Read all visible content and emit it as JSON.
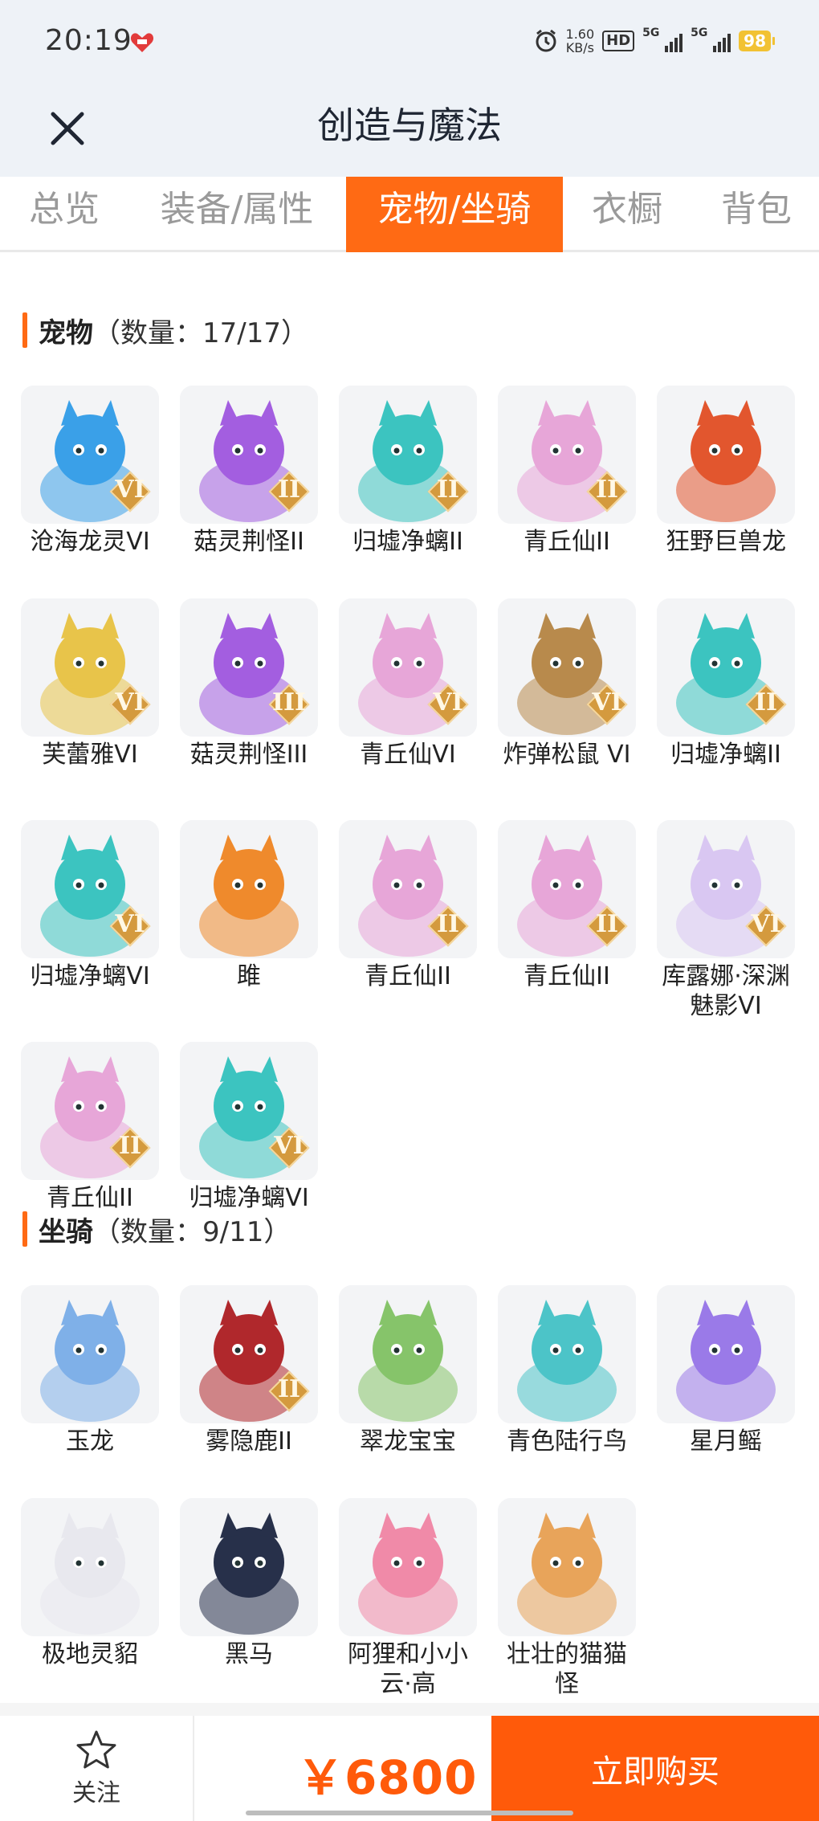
{
  "status_bar": {
    "time": "20:19",
    "speed_value": "1.60",
    "speed_unit": "KB/s",
    "hd_label": "HD",
    "net1": "5G",
    "net2": "5G",
    "battery": "98"
  },
  "header": {
    "title": "创造与魔法",
    "close_icon": "close-icon"
  },
  "tabs": [
    "总览",
    "装备/属性",
    "宠物/坐骑",
    "衣橱",
    "背包"
  ],
  "active_tab": "宠物/坐骑",
  "pets": {
    "title": "宠物",
    "count": "（数量：17/17）",
    "items": [
      {
        "name": "沧海龙灵VI",
        "rank": "VI",
        "color": "#3aa0e8"
      },
      {
        "name": "菇灵荆怪II",
        "rank": "II",
        "color": "#a35ee0"
      },
      {
        "name": "归墟净螭II",
        "rank": "II",
        "color": "#3cc4c0"
      },
      {
        "name": "青丘仙II",
        "rank": "II",
        "color": "#e7a6d8"
      },
      {
        "name": "狂野巨兽龙",
        "rank": "",
        "color": "#e2562e"
      },
      {
        "name": "芙蕾雅VI",
        "rank": "VI",
        "color": "#e8c44a"
      },
      {
        "name": "菇灵荆怪III",
        "rank": "III",
        "color": "#a35ee0"
      },
      {
        "name": "青丘仙VI",
        "rank": "VI",
        "color": "#e7a6d8"
      },
      {
        "name": "炸弹松鼠 VI",
        "rank": "VI",
        "color": "#b88a4c"
      },
      {
        "name": "归墟净螭II",
        "rank": "II",
        "color": "#3cc4c0"
      },
      {
        "name": "归墟净螭VI",
        "rank": "VI",
        "color": "#3cc4c0"
      },
      {
        "name": "雎",
        "rank": "",
        "color": "#ef8a2c"
      },
      {
        "name": "青丘仙II",
        "rank": "II",
        "color": "#e7a6d8"
      },
      {
        "name": "青丘仙II",
        "rank": "II",
        "color": "#e7a6d8"
      },
      {
        "name": "库露娜·深渊魅影VI",
        "rank": "VI",
        "color": "#d9c7f2"
      },
      {
        "name": "青丘仙II",
        "rank": "II",
        "color": "#e7a6d8"
      },
      {
        "name": "归墟净螭VI",
        "rank": "VI",
        "color": "#3cc4c0"
      }
    ]
  },
  "mounts": {
    "title": "坐骑",
    "count": "（数量：9/11）",
    "items": [
      {
        "name": "玉龙",
        "rank": "",
        "color": "#7fb0e8"
      },
      {
        "name": "雾隐鹿II",
        "rank": "II",
        "color": "#b0282c"
      },
      {
        "name": "翠龙宝宝",
        "rank": "",
        "color": "#86c46a"
      },
      {
        "name": "青色陆行鸟",
        "rank": "",
        "color": "#4cc4c8"
      },
      {
        "name": "星月鳐",
        "rank": "",
        "color": "#9a7ae8"
      },
      {
        "name": "极地灵貂",
        "rank": "",
        "color": "#e8e8ee"
      },
      {
        "name": "黑马",
        "rank": "",
        "color": "#27304a"
      },
      {
        "name": "阿狸和小小云·高",
        "rank": "",
        "color": "#f08aa8"
      },
      {
        "name": "壮壮的猫猫怪",
        "rank": "",
        "color": "#e8a45a"
      }
    ]
  },
  "bottom": {
    "follow_label": "关注",
    "price": "￥6800",
    "buy_label": "立即购买"
  },
  "colors": {
    "accent": "#ff6a14",
    "header_bg": "#eef2f7",
    "price": "#ff5a0a"
  }
}
